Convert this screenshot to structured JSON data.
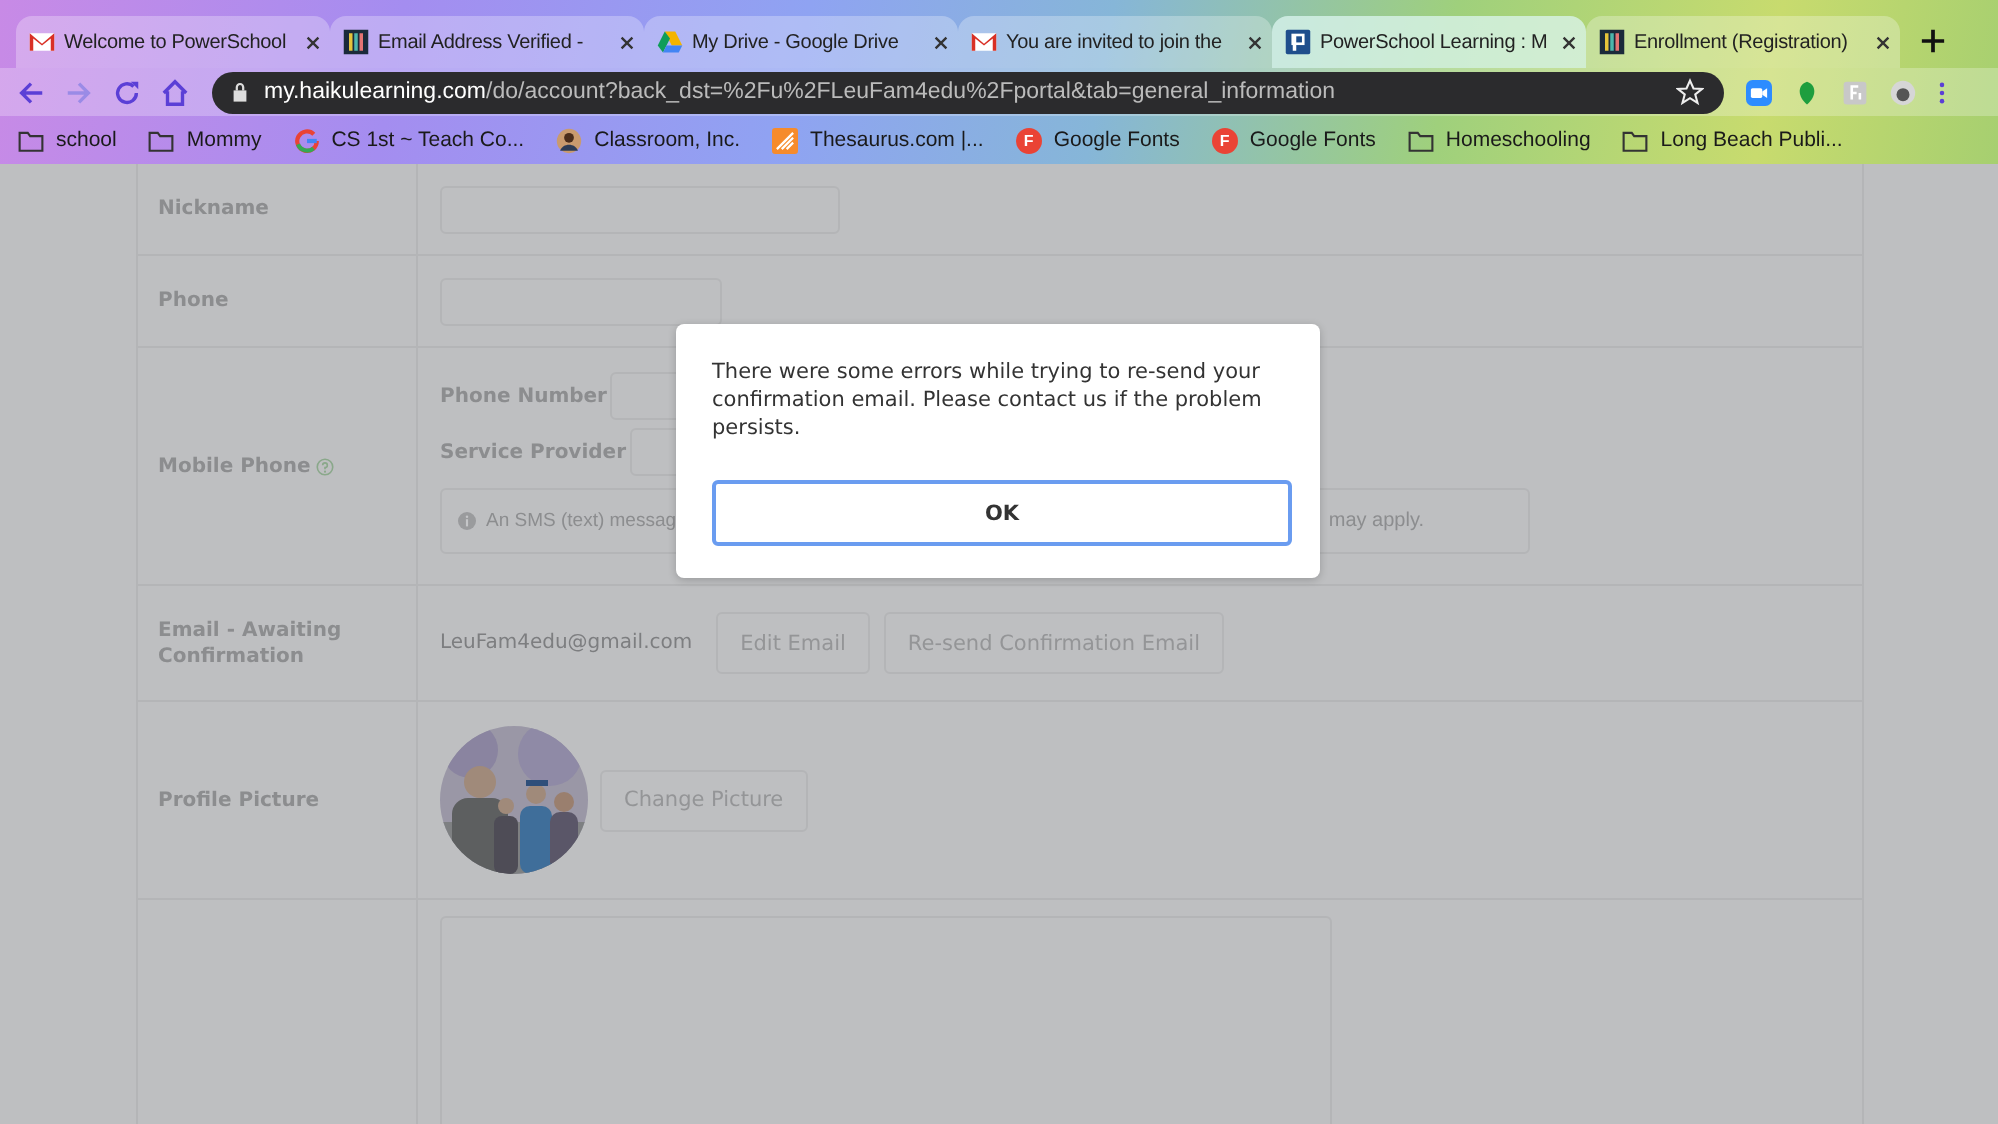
{
  "browser": {
    "tabs": [
      {
        "title": "Welcome to PowerSchool",
        "selected": false
      },
      {
        "title": "Email Address Verified -",
        "selected": false
      },
      {
        "title": "My Drive - Google Drive",
        "selected": false
      },
      {
        "title": "You are invited to join the",
        "selected": false
      },
      {
        "title": "PowerSchool Learning : M",
        "selected": true
      },
      {
        "title": "Enrollment (Registration)",
        "selected": false
      }
    ],
    "address": {
      "host": "my.haikulearning.com",
      "path": "/do/account?back_dst=%2Fu%2FLeuFam4edu%2Fportal&tab=general_information"
    },
    "bookmarks": [
      {
        "label": "school",
        "kind": "folder"
      },
      {
        "label": "Mommy",
        "kind": "folder"
      },
      {
        "label": "CS 1st ~ Teach Co...",
        "kind": "site"
      },
      {
        "label": "Classroom, Inc.",
        "kind": "site"
      },
      {
        "label": "Thesaurus.com |...",
        "kind": "site"
      },
      {
        "label": "Google Fonts",
        "kind": "badge",
        "badge": "F"
      },
      {
        "label": "Google Fonts",
        "kind": "badge",
        "badge": "F"
      },
      {
        "label": "Homeschooling",
        "kind": "folder"
      },
      {
        "label": "Long Beach Publi...",
        "kind": "folder"
      }
    ]
  },
  "form": {
    "rows": [
      {
        "kind": "input",
        "label": "Nickname"
      },
      {
        "kind": "input",
        "label": "Phone"
      },
      {
        "kind": "mobile",
        "label": "Mobile Phone",
        "number_label": "Phone Number",
        "provider_label": "Service Provider",
        "note_start": "An SMS (text) messag",
        "note_end": "may apply."
      },
      {
        "kind": "email",
        "label": "Email - Awaiting Confirmation",
        "value": "LeuFam4edu@gmail.com",
        "buttons": [
          "Edit Email",
          "Re-send Confirmation Email"
        ]
      },
      {
        "kind": "picture",
        "label": "Profile Picture",
        "button": "Change Picture"
      },
      {
        "kind": "textarea"
      }
    ]
  },
  "dialog": {
    "message": "There were some errors while trying to re-send your confirmation email. Please contact us if the problem persists.",
    "button": "OK"
  }
}
